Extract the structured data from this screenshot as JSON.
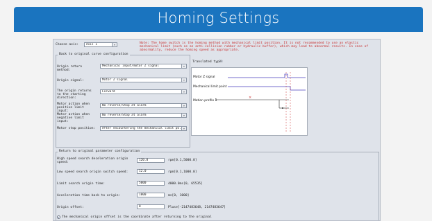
{
  "banner": {
    "title": "Homing Settings"
  },
  "top": {
    "axis_label": "Choose axis:",
    "axis_value": "Axis 1",
    "note": "Note: The home switch is the homing method with mechanical limit position. It is not recommended to use an elastic mechanical limit (such as an anti-collision rubber or hydraulic buffer), which may lead to abnormal results. In case of abnormality, reduce the homing speed as appropriate."
  },
  "config_group": {
    "legend": "Back to original curve configuration",
    "rows": [
      {
        "label": "Origin return method:",
        "value": "Mechanical input/motor Z signal"
      },
      {
        "label": "Origin signal:",
        "value": "Motor Z signal"
      },
      {
        "label": "The origin returns to the starting direction:",
        "value": "Forward"
      },
      {
        "label": "Motor action when positive limit input:",
        "value": "No reverse/Stop at alarm"
      },
      {
        "label": "Motor action when negative limit input:",
        "value": "No reverse/Stop at alarm"
      },
      {
        "label": "Motor stop position:",
        "value": "After encountering the mechanical limit po..."
      }
    ]
  },
  "diagram": {
    "type_label": "Translated type:",
    "type_value": "Z9",
    "labels": [
      "Motor Z signal",
      "Mechanical limit point",
      "Motion profile 1"
    ]
  },
  "param_group": {
    "legend": "Return to original parameter configuration",
    "rows": [
      {
        "label": "High speed search deceleration origin speed:",
        "value": "120.0",
        "unit": "rpm[0.1,5000.0]"
      },
      {
        "label": "Low speed search origin switch speed:",
        "value": "12.0",
        "unit": "rpm[0.1,1000.0]"
      },
      {
        "label": "Limit search origin time:",
        "value": "5000",
        "unit": "4000.0ms[0, 65535]"
      },
      {
        "label": "Acceleration time back to origin:",
        "value": "1000",
        "unit": "ms[0, 1000]"
      },
      {
        "label": "Origin offset:",
        "value": "0",
        "unit": "Pluse[-2147483648, 2147483647]"
      }
    ],
    "radio_text": "The mechanical origin offset is the coordinate after returning to the original"
  }
}
